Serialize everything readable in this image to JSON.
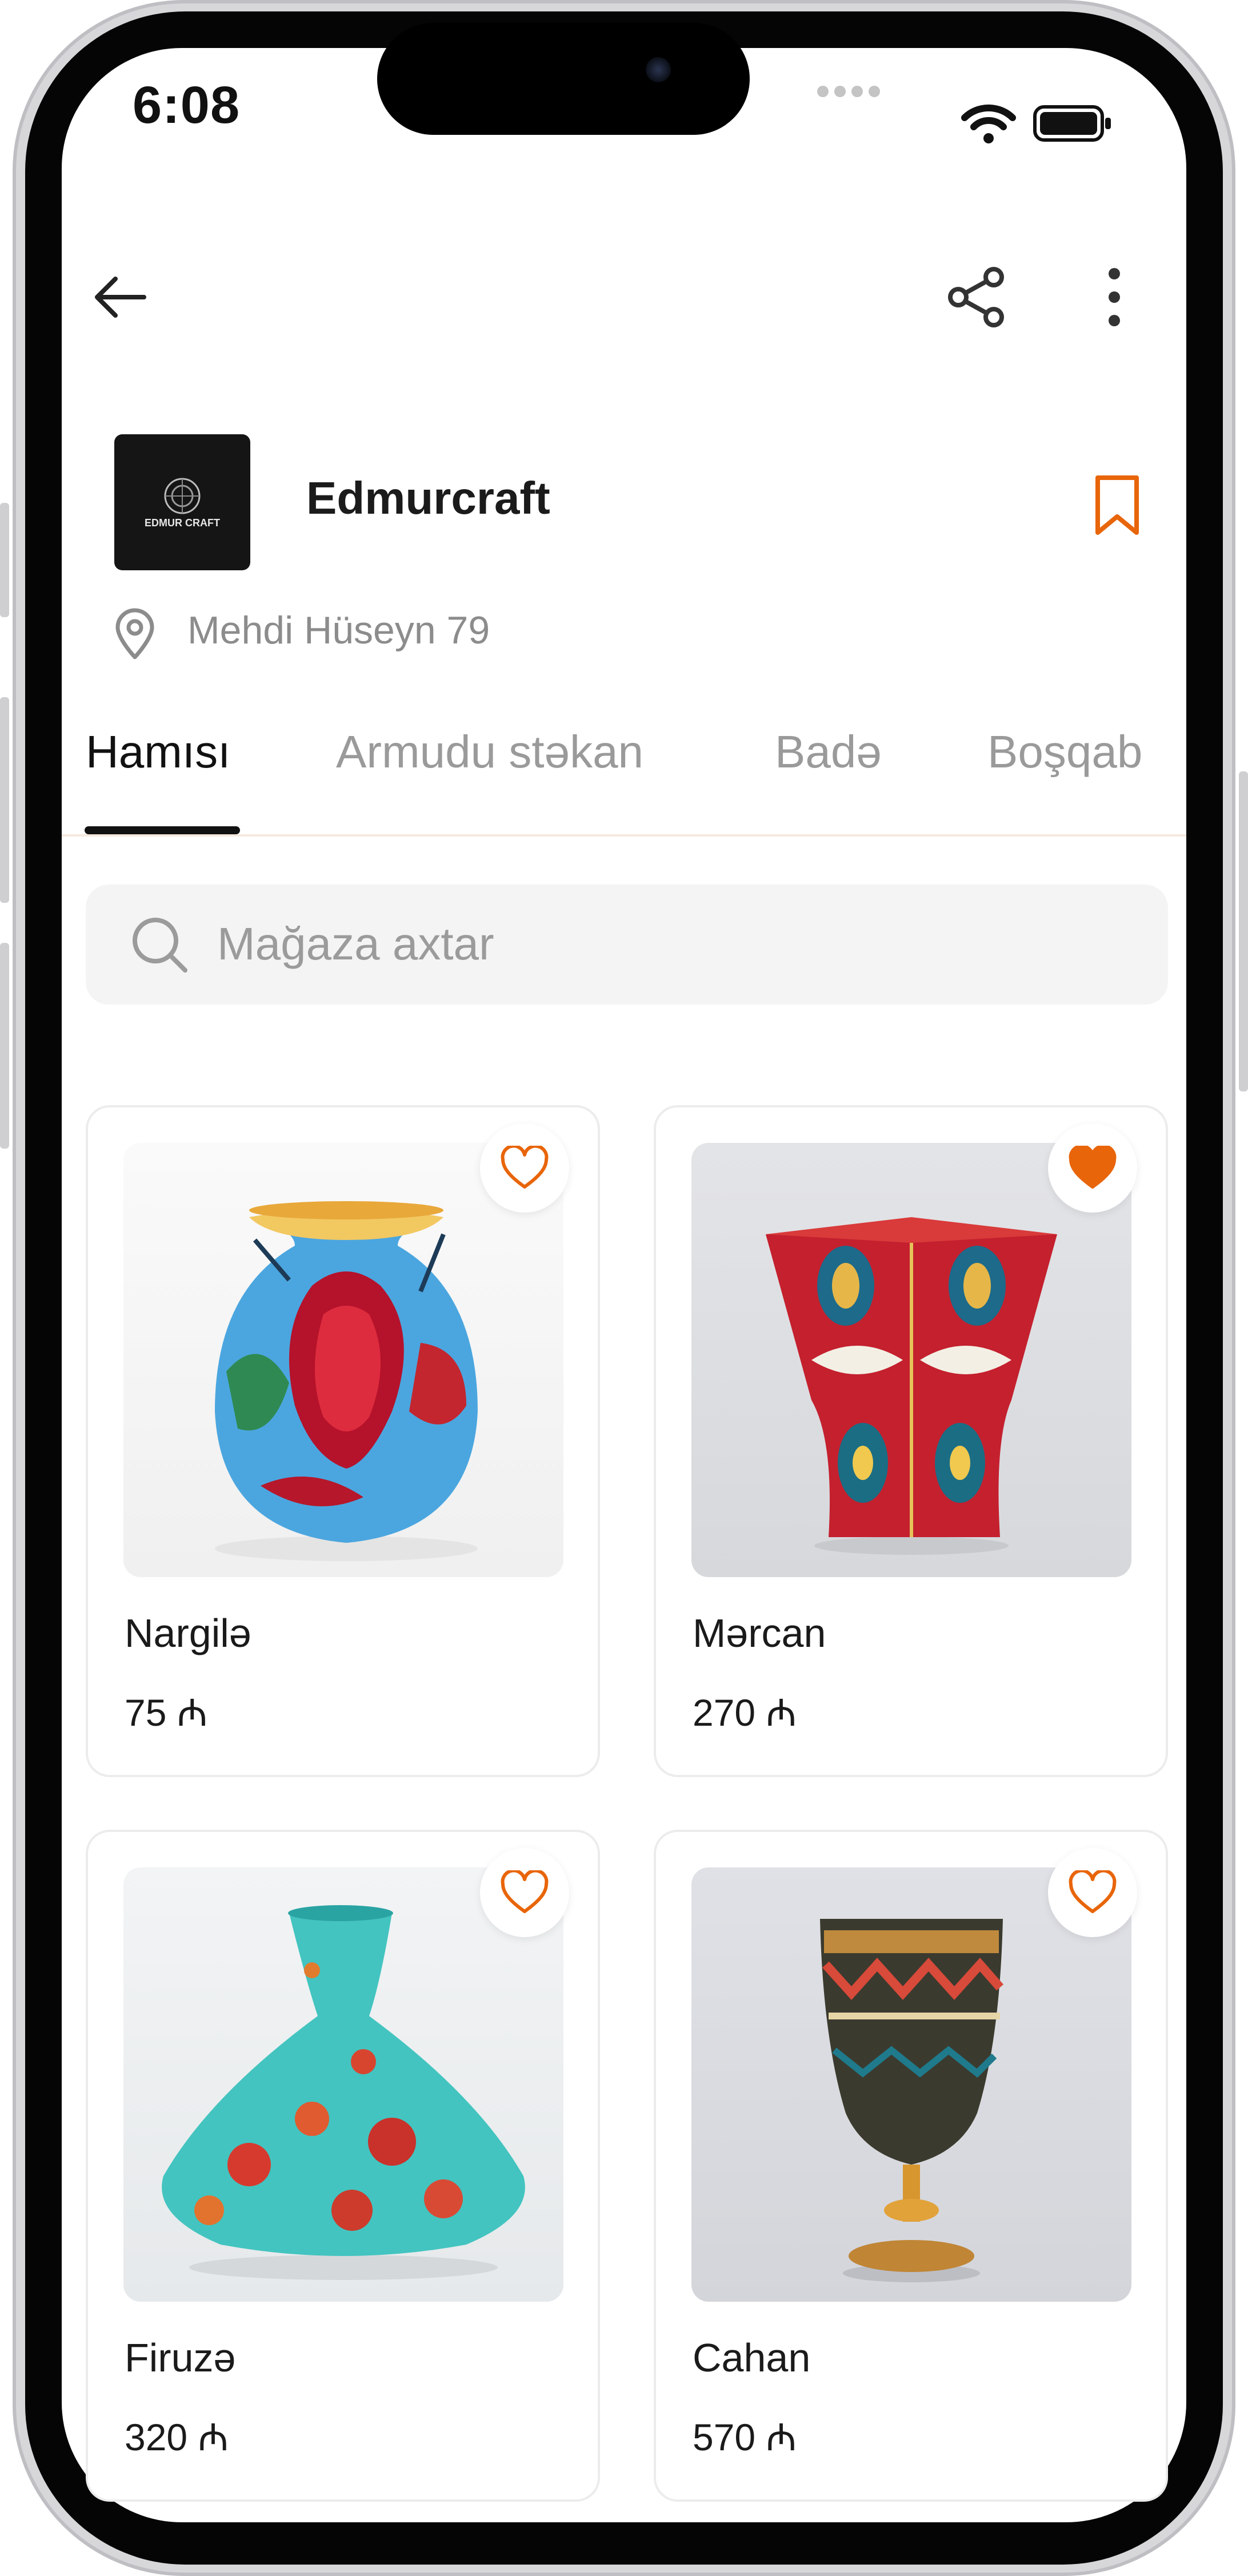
{
  "status_bar": {
    "time": "6:08"
  },
  "store": {
    "name": "Edmurcraft",
    "logo_text": "EDMUR CRAFT",
    "address": "Mehdi Hüseyn 79"
  },
  "tabs": [
    {
      "label": "Hamısı",
      "active": true
    },
    {
      "label": "Armudu stəkan",
      "active": false
    },
    {
      "label": "Badə",
      "active": false
    },
    {
      "label": "Boşqab",
      "active": false
    }
  ],
  "search": {
    "placeholder": "Mağaza axtar"
  },
  "products": [
    {
      "name": "Nargilə",
      "price": "75 ₼",
      "favorite": false
    },
    {
      "name": "Mərcan",
      "price": "270 ₼",
      "favorite": true
    },
    {
      "name": "Firuzə",
      "price": "320 ₼",
      "favorite": false
    },
    {
      "name": "Cahan",
      "price": "570 ₼",
      "favorite": false
    }
  ],
  "icons": {
    "back": "arrow-left-icon",
    "share": "share-icon",
    "more": "more-vertical-icon",
    "bookmark": "bookmark-icon",
    "location": "location-pin-icon",
    "search": "search-icon",
    "favorite": "heart-icon"
  },
  "colors": {
    "accent": "#E8650A",
    "text_primary": "#1A1A1A",
    "text_muted": "#8C8C8C"
  }
}
